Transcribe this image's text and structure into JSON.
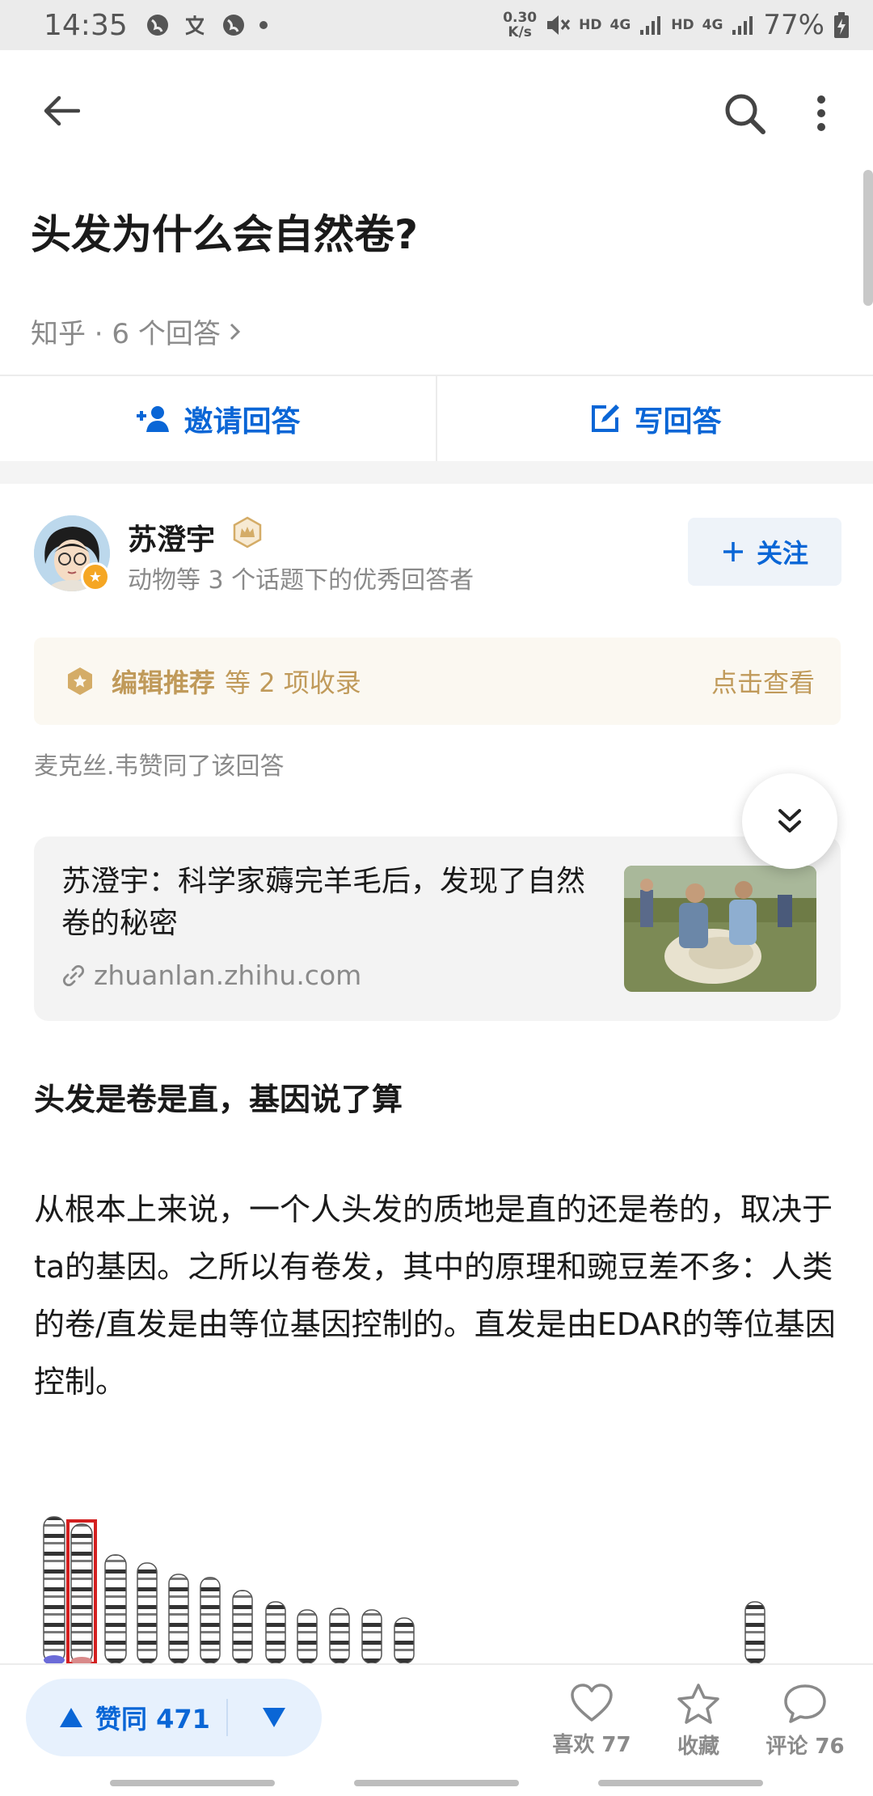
{
  "status_bar": {
    "time": "14:35",
    "left_icons": [
      "globe-icon",
      "translate-icon",
      "globe-icon",
      "dot-icon"
    ],
    "net_speed_value": "0.30",
    "net_speed_unit": "K/s",
    "hd1": "HD",
    "net1": "4G",
    "hd2": "HD",
    "net2": "4G",
    "battery": "77%"
  },
  "question": {
    "title": "头发为什么会自然卷?",
    "source": "知乎 · 6 个回答"
  },
  "actions": {
    "invite": "邀请回答",
    "write": "写回答"
  },
  "author": {
    "name": "苏澄宇",
    "description": "动物等 3 个话题下的优秀回答者",
    "follow": "关注"
  },
  "recommend": {
    "main": "编辑推荐",
    "rest": "等 2 项收录",
    "link": "点击查看"
  },
  "upvoted_by": "麦克丝.韦赞同了该回答",
  "link_card": {
    "title": "苏澄宇：科学家薅完羊毛后，发现了自然卷的秘密",
    "url": "zhuanlan.zhihu.com"
  },
  "content": {
    "heading": "头发是卷是直，基因说了算",
    "paragraph": "从根本上来说，一个人头发的质地是直的还是卷的，取决于ta的基因。之所以有卷发，其中的原理和豌豆差不多：人类的卷/直发是由等位基因控制的。直发是由EDAR的等位基因控制。"
  },
  "bottom_bar": {
    "upvote": "赞同 471",
    "like": "喜欢 77",
    "collect": "收藏",
    "comment": "评论 76"
  },
  "colors": {
    "accent": "#0a66d6",
    "gold": "#c09a5a",
    "muted": "#8a8a8a"
  }
}
